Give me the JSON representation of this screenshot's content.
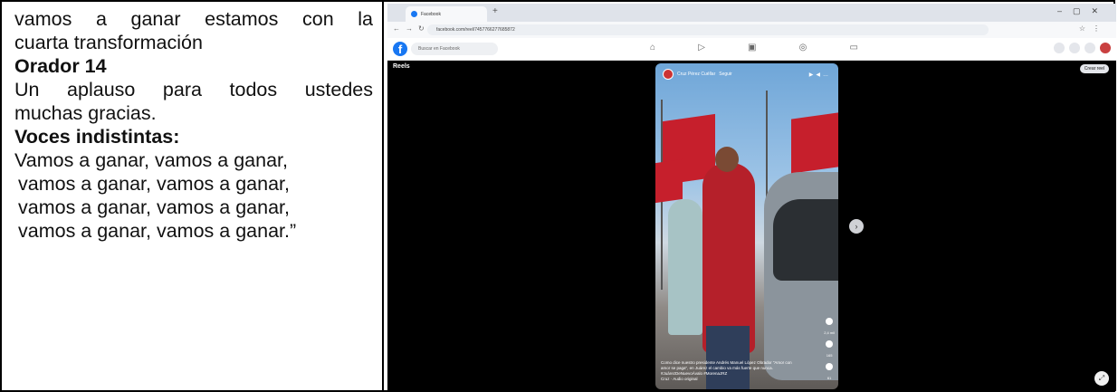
{
  "document": {
    "lines": [
      {
        "text": "vamos a ganar estamos con la",
        "style": "just"
      },
      {
        "text": "cuarta transformación",
        "style": "plain"
      },
      {
        "text": "Orador 14",
        "style": "bold"
      },
      {
        "text": "Un aplauso para todos ustedes",
        "style": "just"
      },
      {
        "text": "muchas gracias.",
        "style": "plain"
      },
      {
        "text": "Voces indistintas:",
        "style": "bold"
      },
      {
        "text": "Vamos a ganar, vamos a ganar,",
        "style": "plain"
      },
      {
        "text": "vamos a ganar, vamos a ganar,",
        "style": "indent"
      },
      {
        "text": "vamos a ganar, vamos a ganar,",
        "style": "indent"
      },
      {
        "text": "vamos a ganar, vamos a ganar.”",
        "style": "indent"
      }
    ]
  },
  "screenshot": {
    "tab_title": "Facebook",
    "url": "facebook.com/reel/7457766277685872",
    "search_placeholder": "Buscar en Facebook",
    "section_label": "Reels",
    "create_button": "Crear reel",
    "reel_author": "Cruz Pérez Cuéllar",
    "reel_follow": "Seguir",
    "reel_caption": "Como dice nuestro presidente Andrés Manuel López Obrador \"Amor con amor se paga\", en Juárez el cambio va más fuerte que nunca.",
    "reel_tags": "#JuárezDeNuevoÁvalo #MorenaJRZ",
    "reel_audio": "Cruz · Audio original",
    "likes": "2,4 mil",
    "comments": "165",
    "shares": "61",
    "colors": {
      "brand": "#1877f2",
      "flag_red": "#c61f2c"
    }
  }
}
